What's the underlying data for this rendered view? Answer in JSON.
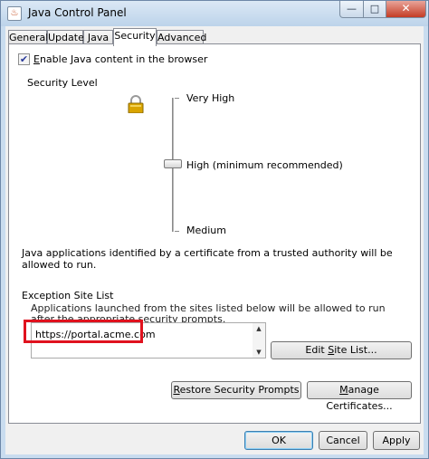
{
  "window": {
    "title": "Java Control Panel",
    "app_icon_glyph": "♨",
    "minimize_glyph": "—",
    "maximize_glyph": "□",
    "close_glyph": "✕"
  },
  "tabs": [
    {
      "label": "General",
      "active": false
    },
    {
      "label": "Update",
      "active": false
    },
    {
      "label": "Java",
      "active": false
    },
    {
      "label": "Security",
      "active": true
    },
    {
      "label": "Advanced",
      "active": false
    }
  ],
  "security": {
    "enable_checkbox": {
      "checked": true,
      "glyph": "✔",
      "label": "Enable Java content in the browser"
    },
    "security_level_label": "Security Level",
    "levels": [
      "Very High",
      "High (minimum recommended)",
      "Medium"
    ],
    "selected_level": "High (minimum recommended)",
    "level_description": "Java applications identified by a certificate from a trusted authority will be allowed to run.",
    "exception_site_list": {
      "title": "Exception Site List",
      "description": "Applications launched from the sites listed below will be allowed to run after the appropriate security prompts.",
      "sites": [
        "https://portal.acme.com"
      ],
      "edit_button": "Edit Site List..."
    },
    "restore_button": "Restore Security Prompts",
    "certificates_button": "Manage Certificates..."
  },
  "footer": {
    "ok": "OK",
    "cancel": "Cancel",
    "apply": "Apply"
  },
  "colors": {
    "highlight_box": "#e0121e",
    "lock_gold": "#d9a400"
  },
  "icons": {
    "lock": "padlock-icon",
    "scroll_up": "▲",
    "scroll_down": "▼"
  }
}
